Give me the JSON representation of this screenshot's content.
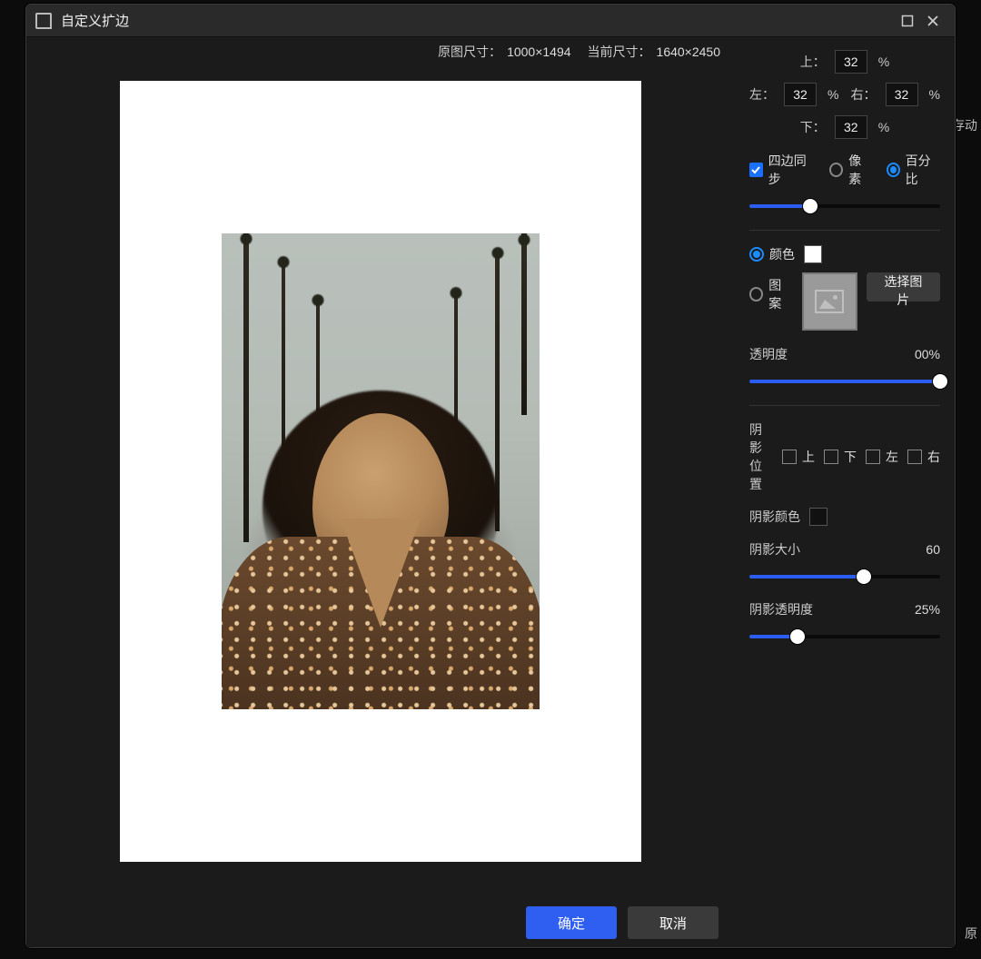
{
  "titlebar": {
    "title": "自定义扩边"
  },
  "dimensions": {
    "orig_label": "原图尺寸：",
    "orig_value": "1000×1494",
    "curr_label": "当前尺寸：",
    "curr_value": "1640×2450"
  },
  "margins": {
    "top_label": "上：",
    "top_value": "32",
    "left_label": "左：",
    "left_value": "32",
    "right_label": "右：",
    "right_value": "32",
    "bottom_label": "下：",
    "bottom_value": "32",
    "unit": "%"
  },
  "sync": {
    "label": "四边同步",
    "checked": true
  },
  "unit_mode": {
    "px_label": "像素",
    "pct_label": "百分比",
    "selected": "pct"
  },
  "sync_slider": {
    "percent": 32
  },
  "fill": {
    "color_label": "颜色",
    "color_selected": true,
    "color_value": "#ffffff",
    "pattern_label": "图案",
    "choose_image": "选择图片"
  },
  "opacity": {
    "label": "透明度",
    "value_text": "00%",
    "percent": 100
  },
  "shadow": {
    "pos_label": "阴影位置",
    "pos_options": {
      "up": "上",
      "down": "下",
      "left": "左",
      "right": "右"
    },
    "color_label": "阴影颜色",
    "size_label": "阴影大小",
    "size_value": "60",
    "size_percent": 60,
    "opacity_label": "阴影透明度",
    "opacity_value": "25%",
    "opacity_percent": 25
  },
  "actions": {
    "ok": "确定",
    "cancel": "取消"
  },
  "behind": {
    "a": "存动",
    "b": "原"
  }
}
